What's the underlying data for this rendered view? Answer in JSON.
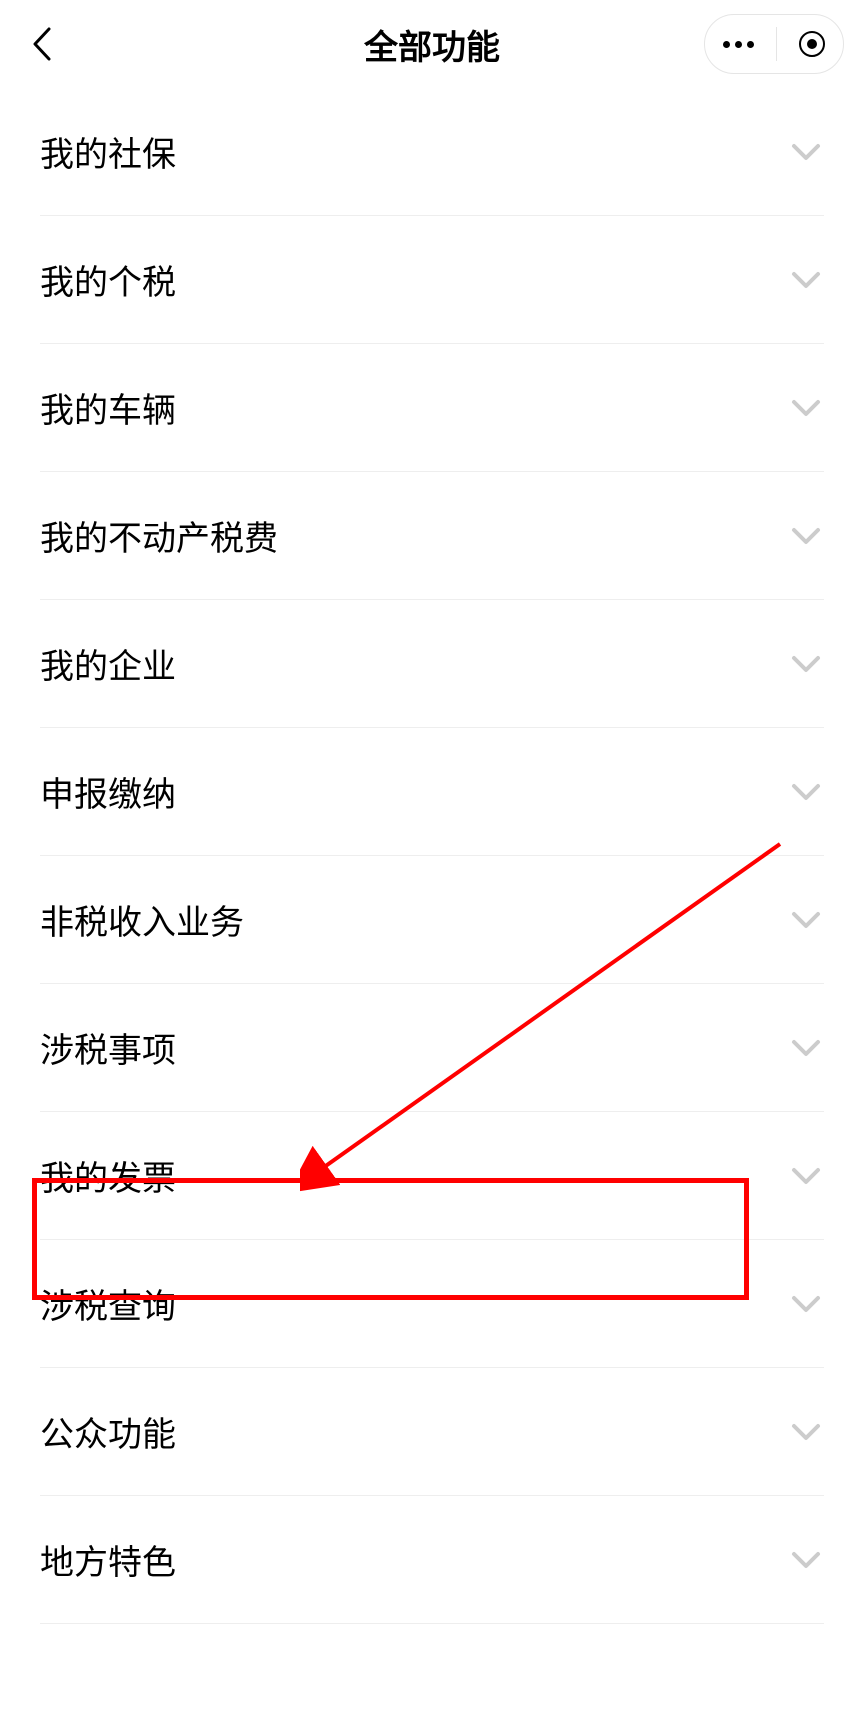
{
  "header": {
    "title": "全部功能"
  },
  "menu": {
    "items": [
      {
        "label": "我的社保",
        "key": "my-social-insurance"
      },
      {
        "label": "我的个税",
        "key": "my-income-tax"
      },
      {
        "label": "我的车辆",
        "key": "my-vehicle"
      },
      {
        "label": "我的不动产税费",
        "key": "my-real-estate-tax"
      },
      {
        "label": "我的企业",
        "key": "my-enterprise"
      },
      {
        "label": "申报缴纳",
        "key": "declaration-payment"
      },
      {
        "label": "非税收入业务",
        "key": "non-tax-revenue"
      },
      {
        "label": "涉税事项",
        "key": "tax-matters"
      },
      {
        "label": "我的发票",
        "key": "my-invoice"
      },
      {
        "label": "涉税查询",
        "key": "tax-query"
      },
      {
        "label": "公众功能",
        "key": "public-functions"
      },
      {
        "label": "地方特色",
        "key": "local-features"
      }
    ]
  },
  "annotation": {
    "highlighted_index": 9,
    "color": "#ff0000"
  }
}
